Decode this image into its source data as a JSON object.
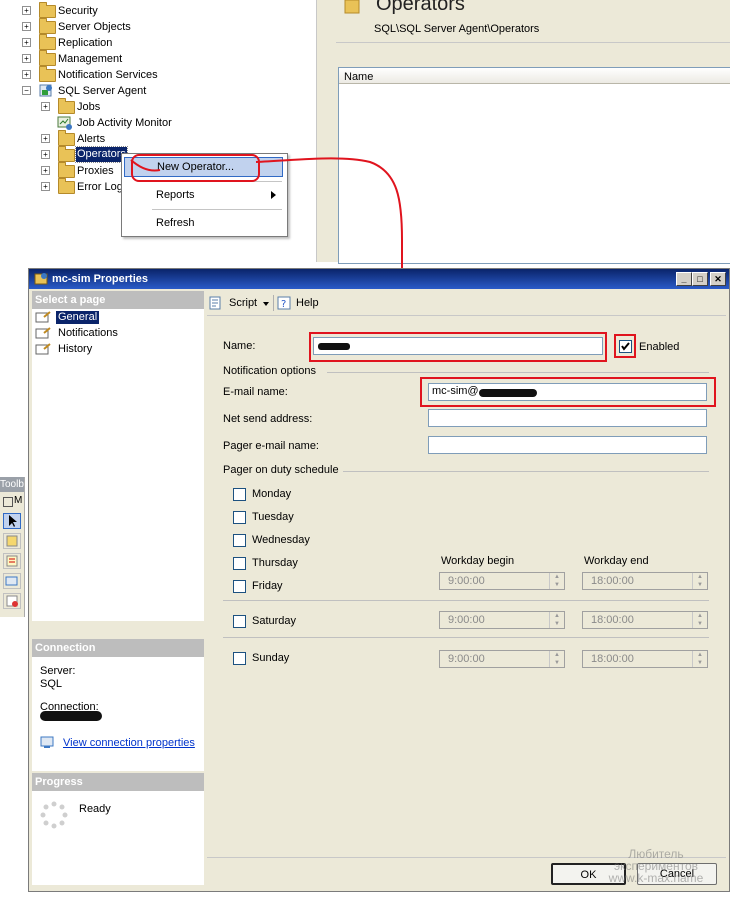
{
  "object_explorer": {
    "items": [
      {
        "label": "Security",
        "toggle": "+"
      },
      {
        "label": "Server Objects",
        "toggle": "+"
      },
      {
        "label": "Replication",
        "toggle": "+"
      },
      {
        "label": "Management",
        "toggle": "+"
      },
      {
        "label": "Notification Services",
        "toggle": "+"
      },
      {
        "label": "SQL Server Agent",
        "toggle": "−"
      },
      {
        "label": "Jobs",
        "toggle": "+"
      },
      {
        "label": "Job Activity Monitor",
        "toggle": ""
      },
      {
        "label": "Alerts",
        "toggle": "+"
      },
      {
        "label": "Operators",
        "toggle": "+"
      },
      {
        "label": "Proxies",
        "toggle": "+"
      },
      {
        "label": "Error Log",
        "toggle": "+"
      }
    ]
  },
  "context_menu": {
    "new_operator": "New Operator...",
    "reports": "Reports",
    "refresh": "Refresh"
  },
  "summary": {
    "title": "Operators",
    "path": "SQL\\SQL Server Agent\\Operators",
    "column_name": "Name"
  },
  "toolbox": {
    "title": "Toolb",
    "letter": "M"
  },
  "dialog": {
    "title": "mc-sim Properties",
    "select_page_header": "Select a page",
    "pages": [
      "General",
      "Notifications",
      "History"
    ],
    "toolbar": {
      "script": "Script",
      "help": "Help"
    },
    "labels": {
      "name": "Name:",
      "enabled": "Enabled",
      "notification_options": "Notification options",
      "email": "E-mail name:",
      "net_send": "Net send address:",
      "pager_email": "Pager e-mail name:",
      "pager_schedule": "Pager on duty schedule",
      "workday_begin": "Workday begin",
      "workday_end": "Workday end"
    },
    "values": {
      "email_prefix": "mc-sim@",
      "net_send": "",
      "pager_email": ""
    },
    "days": [
      "Monday",
      "Tuesday",
      "Wednesday",
      "Thursday",
      "Friday",
      "Saturday",
      "Sunday"
    ],
    "times": {
      "begin": "9:00:00",
      "end": "18:00:00"
    },
    "connection": {
      "header": "Connection",
      "server_label": "Server:",
      "server_value": "SQL",
      "connection_label": "Connection:",
      "view_link": "View connection properties"
    },
    "progress": {
      "header": "Progress",
      "status": "Ready"
    },
    "buttons": {
      "ok": "OK",
      "cancel": "Cancel"
    }
  },
  "watermark": [
    "Любитель",
    "экспериментов",
    "www.k-max.name"
  ]
}
